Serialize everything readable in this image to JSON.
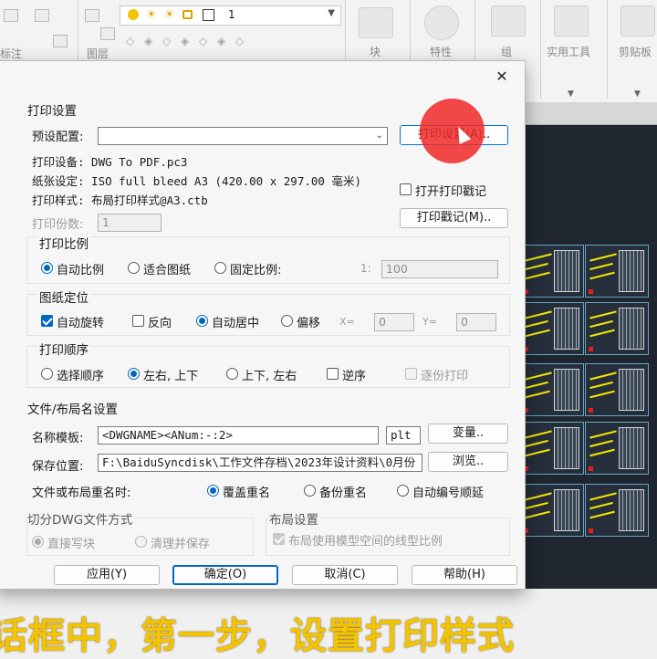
{
  "ribbon": {
    "annotate_label": "标注",
    "layer_label": "图层",
    "block_label": "块",
    "properties_label": "特性",
    "group_label": "组",
    "utilities_label": "实用工具",
    "clipboard_label": "剪贴板",
    "layer_combo_value": "1"
  },
  "dialog": {
    "close_glyph": "✕",
    "print_settings": {
      "title": "打印设置",
      "preset_label": "预设配置:",
      "preset_value": "",
      "print_setup_button": "打印设置(A)..",
      "device_line": "打印设备: DWG To PDF.pc3",
      "paper_line": "纸张设定: ISO full bleed A3 (420.00 x 297.00 毫米)",
      "style_line": "打印样式: 布局打印样式@A3.ctb",
      "open_stamp_label": "打开打印戳记",
      "copies_label": "打印份数:",
      "copies_value": "1",
      "stamp_button": "打印戳记(M).."
    },
    "scale": {
      "title": "打印比例",
      "auto": "自动比例",
      "fit": "适合图纸",
      "fixed": "固定比例:",
      "ratio_prefix": "1:",
      "ratio_value": "100"
    },
    "position": {
      "title": "图纸定位",
      "auto_rotate": "自动旋转",
      "reverse": "反向",
      "auto_center": "自动居中",
      "offset": "偏移",
      "x_label": "X=",
      "x_value": "0",
      "y_label": "Y=",
      "y_value": "0"
    },
    "order": {
      "title": "打印顺序",
      "selection": "选择顺序",
      "lr_tb": "左右, 上下",
      "tb_lr": "上下, 左右",
      "reverse": "逆序",
      "collate": "逐份打印"
    },
    "file": {
      "title": "文件/布局名设置",
      "template_label": "名称模板:",
      "template_value": "<DWGNAME><ANum:-:2>",
      "ext_value": "plt",
      "variable_button": "变量..",
      "save_label": "保存位置:",
      "save_value": "F:\\BaiduSyncdisk\\工作文件存档\\2023年设计资料\\0月份",
      "browse_button": "浏览..",
      "rename_label": "文件或布局重名时:",
      "overwrite": "覆盖重名",
      "backup": "备份重名",
      "auto_number": "自动编号顺延"
    },
    "cut": {
      "title": "切分DWG文件方式",
      "write_block": "直接写块",
      "clean_save": "清理并保存"
    },
    "layout": {
      "title": "布局设置",
      "model_linetype": "布局使用模型空间的线型比例"
    },
    "buttons": {
      "apply": "应用(Y)",
      "ok": "确定(O)",
      "cancel": "取消(C)",
      "help": "帮助(H)"
    }
  },
  "subtitle": "话框中，第一步，设置打印样式",
  "colors": {
    "accent": "#0067c0",
    "subtitle": "#f5c400",
    "click_marker": "#f02828",
    "canvas": "#1f2630"
  }
}
